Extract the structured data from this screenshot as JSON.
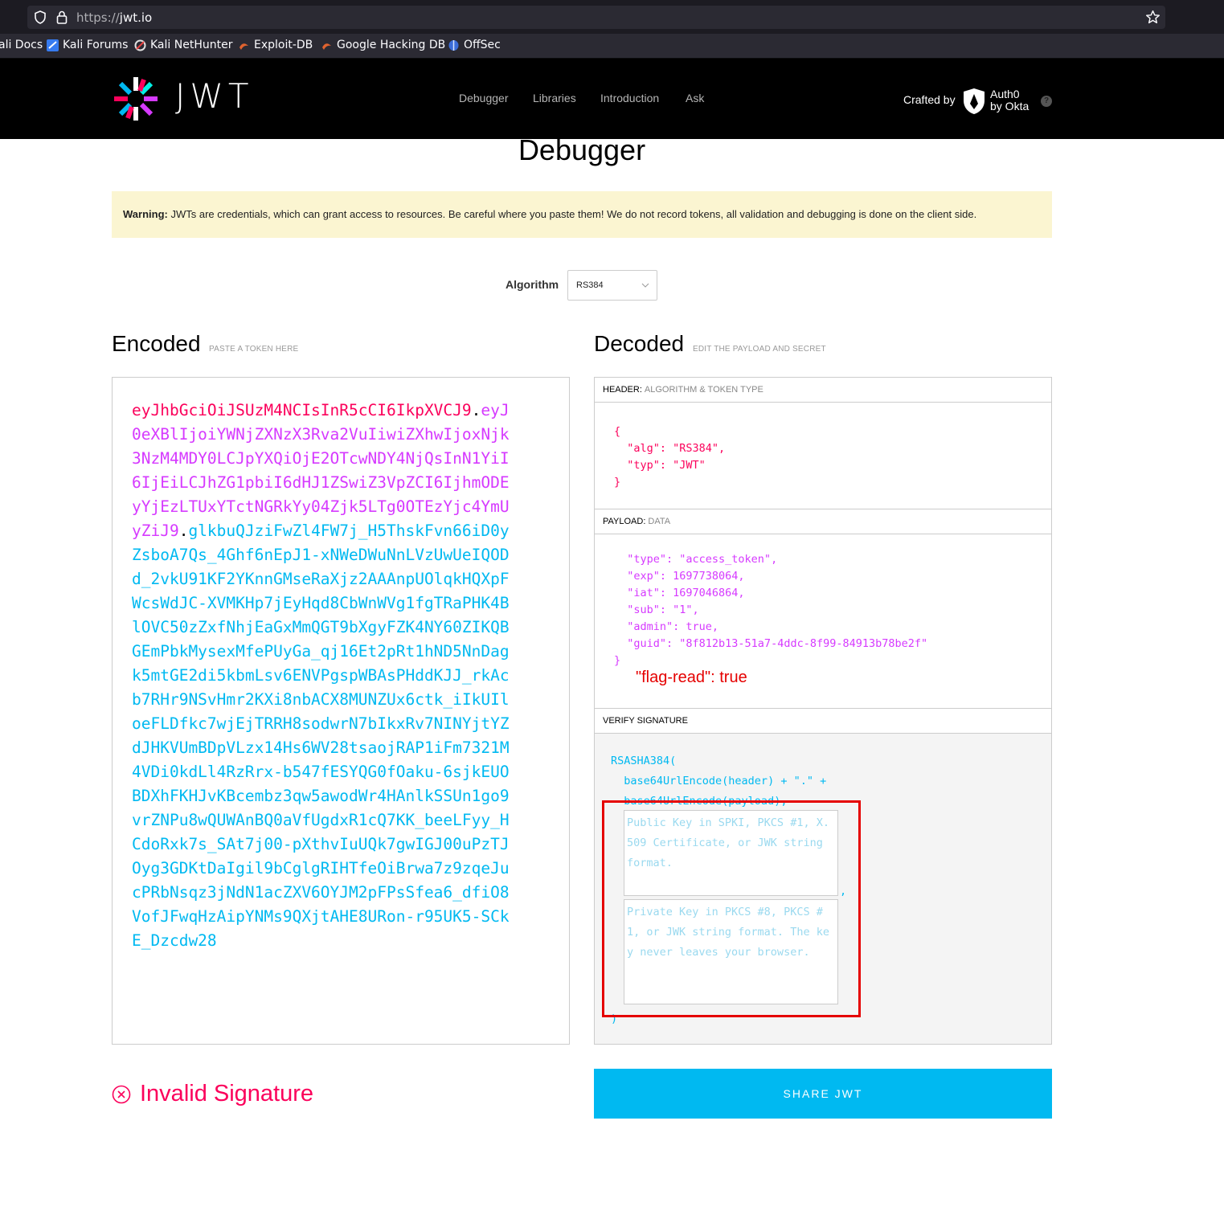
{
  "browser": {
    "url_scheme": "https://",
    "url_host": "jwt.io",
    "bookmarks": [
      {
        "label": "ali Docs",
        "icon": "kali-docs-icon"
      },
      {
        "label": "Kali Forums",
        "icon": "kali-forums-icon"
      },
      {
        "label": "Kali NetHunter",
        "icon": "kali-nethunter-icon"
      },
      {
        "label": "Exploit-DB",
        "icon": "exploit-db-icon"
      },
      {
        "label": "Google Hacking DB",
        "icon": "ghdb-icon"
      },
      {
        "label": "OffSec",
        "icon": "offsec-icon"
      }
    ]
  },
  "header": {
    "logo_text": "JWT",
    "nav": [
      "Debugger",
      "Libraries",
      "Introduction",
      "Ask"
    ],
    "crafted_by": "Crafted by",
    "auth0_line1": "Auth0",
    "auth0_line2": "by Okta",
    "help": "?"
  },
  "main": {
    "title": "Debugger",
    "warning_bold": "Warning:",
    "warning_text": " JWTs are credentials, which can grant access to resources. Be careful where you paste them! We do not record tokens, all validation and debugging is done on the client side.",
    "algorithm_label": "Algorithm",
    "algorithm_value": "RS384"
  },
  "encoded": {
    "title": "Encoded",
    "subtitle": "PASTE A TOKEN HERE",
    "token_header": "eyJhbGciOiJSUzM4NCIsInR5cCI6IkpXVCJ9",
    "token_payload": "eyJ0eXBlIjoiYWNjZXNzX3Rva2VuIiwiZXhwIjoxNjk3NzM4MDY0LCJpYXQiOjE2OTcwNDY4NjQsInN1YiI6IjEiLCJhZG1pbiI6dHJ1ZSwiZ3VpZCI6IjhmODEyYjEzLTUxYTctNGRkYy04Zjk5LTg0OTEzYjc4YmUyZiJ9",
    "token_signature": "glkbuQJziFwZl4FW7j_H5ThskFvn66iD0yZsboA7Qs_4Ghf6nEpJ1-xNWeDWuNnLVzUwUeIQODd_2vkU91KF2YKnnGMseRaXjz2AAAnpUOlqkHQXpFWcsWdJC-XVMKHp7jEyHqd8CbWnWVg1fgTRaPHK4BlOVC50zZxfNhjEaGxMmQGT9bXgyFZK4NY60ZIKQBGEmPbkMysexMfePUyGa_qj16Et2pRt1hND5NnDagk5mtGE2di5kbmLsv6ENVPgspWBAsPHddKJJ_rkAcb7RHr9NSvHmr2KXi8nbACX8MUNZUx6ctk_iIkUIloeFLDfkc7wjEjTRRH8sodwrN7bIkxRv7NINYjtYZdJHKVUmBDpVLzx14Hs6WV28tsaojRAP1iFm7321M4VDi0kdLl4RzRrx-b547fESYQG0fOaku-6sjkEUOBDXhFKHJvKBcembz3qw5awodWr4HAnlkSSUn1go9vrZNPu8wQUWAnBQ0aVfUgdxR1cQ7KK_beeLFyy_HCdoRxk7s_SAt7j00-pXthvIuUQk7gwIGJ00uPzTJOyg3GDKtDaIgil9bCglgRIHTfeOiBrwa7z9zqeJucPRbNsqz3jNdN1acZXV6OYJM2pFPsSfea6_dfiO8VofJFwqHzAipYNMs9QXjtAHE8URon-r95UK5-SCkE_Dzcdw28"
  },
  "decoded": {
    "title": "Decoded",
    "subtitle": "EDIT THE PAYLOAD AND SECRET",
    "header_label": "HEADER:",
    "header_sub": "ALGORITHM & TOKEN TYPE",
    "header_json": "{\n  \"alg\": \"RS384\",\n  \"typ\": \"JWT\"\n}",
    "payload_label": "PAYLOAD:",
    "payload_sub": "DATA",
    "payload_json": "  \"type\": \"access_token\",\n  \"exp\": 1697738064,\n  \"iat\": 1697046864,\n  \"sub\": \"1\",\n  \"admin\": true,\n  \"guid\": \"8f812b13-51a7-4ddc-8f99-84913b78be2f\"",
    "payload_close": "}",
    "flag_note": "\"flag-read\": true",
    "verify_label": "VERIFY SIGNATURE",
    "verify_code": "RSASHA384(\n  base64UrlEncode(header) + \".\" +\n  base64UrlEncode(payload),",
    "public_key_placeholder": "Public Key in SPKI, PKCS #1, X.509 Certificate, or JWK string format.",
    "private_key_placeholder": "Private Key in PKCS #8, PKCS #1, or JWK string format. The key never leaves your browser.",
    "comma": ",",
    "close_paren": ")"
  },
  "status": {
    "invalid_text": "Invalid Signature"
  },
  "share_label": "SHARE JWT",
  "colors": {
    "header_red": "#fb015b",
    "payload_purple": "#d63aff",
    "signature_blue": "#00b9f1",
    "warning_bg": "#fbf5d1",
    "annotation_red": "#e50000"
  }
}
